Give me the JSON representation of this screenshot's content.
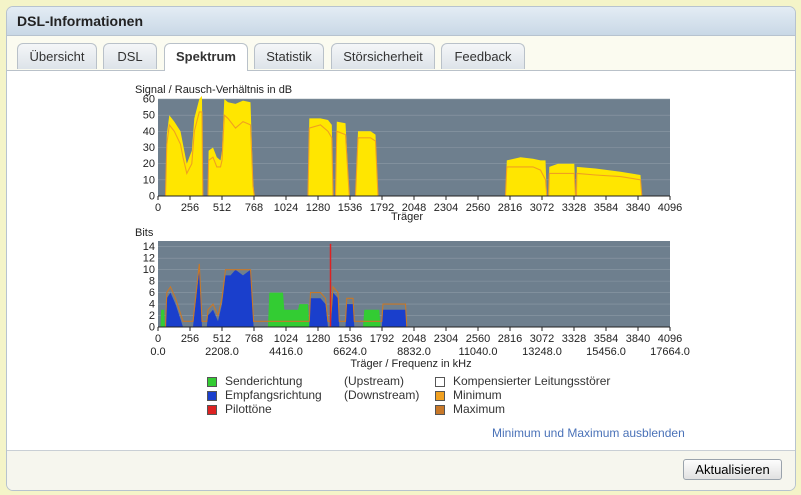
{
  "window": {
    "title": "DSL-Informationen"
  },
  "tabs": [
    {
      "label": "Übersicht",
      "active": false
    },
    {
      "label": "DSL",
      "active": false
    },
    {
      "label": "Spektrum",
      "active": true
    },
    {
      "label": "Statistik",
      "active": false
    },
    {
      "label": "Störsicherheit",
      "active": false
    },
    {
      "label": "Feedback",
      "active": false
    }
  ],
  "chart_data": [
    {
      "type": "area",
      "ylabel": "Signal / Rausch-Verhältnis in dB",
      "xlabel": "Träger",
      "xlim": [
        0,
        4096
      ],
      "ylim": [
        0,
        60
      ],
      "yticks": [
        "0",
        "10",
        "20",
        "30",
        "40",
        "50",
        "60"
      ],
      "xticks": [
        "0",
        "256",
        "512",
        "768",
        "1024",
        "1280",
        "1536",
        "1792",
        "2048",
        "2304",
        "2560",
        "2816",
        "3072",
        "3328",
        "3584",
        "3840",
        "4096"
      ],
      "grid": true,
      "series": [
        {
          "values": [
            [
              60,
              0
            ],
            [
              70,
              38
            ],
            [
              90,
              50
            ],
            [
              130,
              46
            ],
            [
              180,
              40
            ],
            [
              200,
              32
            ],
            [
              230,
              20
            ],
            [
              270,
              28
            ],
            [
              290,
              48
            ],
            [
              330,
              60
            ],
            [
              352,
              62
            ],
            [
              358,
              0
            ],
            [
              400,
              0
            ],
            [
              405,
              28
            ],
            [
              440,
              30
            ],
            [
              470,
              24
            ],
            [
              500,
              22
            ],
            [
              512,
              28
            ],
            [
              530,
              60
            ],
            [
              560,
              58
            ],
            [
              620,
              57
            ],
            [
              680,
              59
            ],
            [
              740,
              58
            ],
            [
              760,
              10
            ],
            [
              770,
              0
            ],
            [
              1200,
              0
            ],
            [
              1210,
              48
            ],
            [
              1300,
              48
            ],
            [
              1360,
              47
            ],
            [
              1390,
              44
            ],
            [
              1400,
              0
            ],
            [
              1420,
              0
            ],
            [
              1430,
              46
            ],
            [
              1500,
              45
            ],
            [
              1530,
              0
            ],
            [
              1580,
              0
            ],
            [
              1600,
              40
            ],
            [
              1700,
              40
            ],
            [
              1740,
              38
            ],
            [
              1760,
              0
            ],
            [
              1770,
              0
            ],
            [
              2780,
              0
            ],
            [
              2790,
              22
            ],
            [
              2900,
              24
            ],
            [
              3000,
              23
            ],
            [
              3060,
              22
            ],
            [
              3100,
              22
            ],
            [
              3110,
              0
            ],
            [
              3125,
              0
            ],
            [
              3130,
              18
            ],
            [
              3200,
              20
            ],
            [
              3330,
              20
            ],
            [
              3340,
              0
            ],
            [
              3348,
              0
            ],
            [
              3350,
              18
            ],
            [
              3500,
              17
            ],
            [
              3700,
              15
            ],
            [
              3860,
              13
            ],
            [
              3870,
              0
            ]
          ]
        },
        {
          "values": [
            [
              60,
              0
            ],
            [
              70,
              32
            ],
            [
              90,
              44
            ],
            [
              130,
              40
            ],
            [
              180,
              32
            ],
            [
              200,
              24
            ],
            [
              230,
              14
            ],
            [
              270,
              20
            ],
            [
              290,
              40
            ],
            [
              330,
              52
            ],
            [
              352,
              52
            ],
            [
              358,
              0
            ],
            [
              400,
              0
            ],
            [
              405,
              22
            ],
            [
              440,
              24
            ],
            [
              470,
              18
            ],
            [
              500,
              18
            ],
            [
              512,
              22
            ],
            [
              530,
              50
            ],
            [
              560,
              48
            ],
            [
              620,
              42
            ],
            [
              680,
              46
            ],
            [
              740,
              44
            ],
            [
              760,
              6
            ],
            [
              770,
              0
            ],
            [
              1200,
              0
            ],
            [
              1210,
              42
            ],
            [
              1300,
              44
            ],
            [
              1360,
              40
            ],
            [
              1390,
              36
            ],
            [
              1400,
              0
            ],
            [
              1420,
              0
            ],
            [
              1430,
              40
            ],
            [
              1500,
              38
            ],
            [
              1530,
              0
            ],
            [
              1580,
              0
            ],
            [
              1600,
              36
            ],
            [
              1700,
              36
            ],
            [
              1740,
              34
            ],
            [
              1760,
              0
            ],
            [
              1770,
              0
            ],
            [
              2780,
              0
            ],
            [
              2790,
              18
            ],
            [
              2900,
              18
            ],
            [
              3000,
              18
            ],
            [
              3060,
              16
            ],
            [
              3100,
              10
            ],
            [
              3110,
              0
            ],
            [
              3125,
              0
            ],
            [
              3130,
              14
            ],
            [
              3200,
              14
            ],
            [
              3330,
              14
            ],
            [
              3340,
              0
            ],
            [
              3348,
              0
            ],
            [
              3350,
              14
            ],
            [
              3500,
              13
            ],
            [
              3700,
              12
            ],
            [
              3860,
              10
            ],
            [
              3870,
              0
            ]
          ]
        }
      ]
    },
    {
      "type": "area",
      "ylabel": "Bits",
      "xlabel": "Träger / Frequenz in kHz",
      "xlim": [
        0,
        4096
      ],
      "ylim": [
        0,
        15
      ],
      "yticks": [
        "0",
        "2",
        "4",
        "6",
        "8",
        "10",
        "12",
        "14"
      ],
      "xticks": [
        "0",
        "256",
        "512",
        "768",
        "1024",
        "1280",
        "1536",
        "1792",
        "2048",
        "2304",
        "2560",
        "2816",
        "3072",
        "3328",
        "3584",
        "3840",
        "4096"
      ],
      "xticks_freq": [
        "0.0",
        "2208.0",
        "4416.0",
        "6624.0",
        "8832.0",
        "11040.0",
        "13248.0",
        "15456.0",
        "17664.0"
      ],
      "grid": true,
      "series": [
        {
          "name": "Senderichtung",
          "values": [
            [
              20,
              0
            ],
            [
              25,
              3
            ],
            [
              50,
              3
            ],
            [
              55,
              0
            ],
            [
              880,
              0
            ],
            [
              890,
              6
            ],
            [
              1000,
              6
            ],
            [
              1010,
              3
            ],
            [
              1120,
              3
            ],
            [
              1130,
              4
            ],
            [
              1200,
              4
            ],
            [
              1210,
              0
            ],
            [
              1640,
              0
            ],
            [
              1650,
              3
            ],
            [
              1770,
              3
            ],
            [
              1780,
              0
            ]
          ]
        },
        {
          "name": "Empfangsrichtung",
          "values": [
            [
              60,
              0
            ],
            [
              70,
              5
            ],
            [
              100,
              6
            ],
            [
              140,
              4
            ],
            [
              170,
              2
            ],
            [
              200,
              0
            ],
            [
              280,
              0
            ],
            [
              330,
              10
            ],
            [
              352,
              0
            ],
            [
              390,
              0
            ],
            [
              400,
              2
            ],
            [
              440,
              3
            ],
            [
              480,
              1
            ],
            [
              512,
              4
            ],
            [
              540,
              9
            ],
            [
              580,
              9
            ],
            [
              620,
              10
            ],
            [
              680,
              9
            ],
            [
              740,
              10
            ],
            [
              765,
              0
            ],
            [
              1210,
              0
            ],
            [
              1220,
              5
            ],
            [
              1300,
              5
            ],
            [
              1340,
              4
            ],
            [
              1360,
              0
            ],
            [
              1380,
              0
            ],
            [
              1400,
              6
            ],
            [
              1440,
              5
            ],
            [
              1450,
              0
            ],
            [
              1500,
              0
            ],
            [
              1510,
              4
            ],
            [
              1560,
              4
            ],
            [
              1570,
              0
            ],
            [
              1790,
              0
            ],
            [
              1800,
              3
            ],
            [
              1980,
              3
            ],
            [
              1990,
              0
            ]
          ]
        },
        {
          "name": "Maximum",
          "values": [
            [
              60,
              0
            ],
            [
              70,
              6
            ],
            [
              100,
              7
            ],
            [
              140,
              5
            ],
            [
              170,
              3
            ],
            [
              200,
              1
            ],
            [
              280,
              1
            ],
            [
              330,
              11
            ],
            [
              352,
              1
            ],
            [
              390,
              1
            ],
            [
              400,
              3
            ],
            [
              440,
              4
            ],
            [
              480,
              2
            ],
            [
              512,
              5
            ],
            [
              540,
              10
            ],
            [
              580,
              10
            ],
            [
              620,
              10
            ],
            [
              680,
              10
            ],
            [
              740,
              10
            ],
            [
              765,
              1
            ],
            [
              1210,
              1
            ],
            [
              1220,
              6
            ],
            [
              1300,
              6
            ],
            [
              1340,
              5
            ],
            [
              1360,
              1
            ],
            [
              1380,
              1
            ],
            [
              1400,
              7
            ],
            [
              1440,
              6
            ],
            [
              1450,
              1
            ],
            [
              1500,
              1
            ],
            [
              1510,
              5
            ],
            [
              1560,
              5
            ],
            [
              1570,
              1
            ],
            [
              1790,
              1
            ],
            [
              1800,
              4
            ],
            [
              1980,
              4
            ],
            [
              1990,
              0
            ]
          ]
        },
        {
          "name": "Pilottöne",
          "values": [
            [
              1380,
              14.5
            ]
          ]
        }
      ]
    }
  ],
  "legend": {
    "items": [
      {
        "label": "Senderichtung",
        "note": "(Upstream)",
        "color": "#33cc33"
      },
      {
        "label": "Empfangsrichtung",
        "note": "(Downstream)",
        "color": "#1a3fcc"
      },
      {
        "label": "Pilottöne",
        "color": "#dd2222"
      },
      {
        "label": "Kompensierter Leitungsstörer",
        "color": "#ffffff"
      },
      {
        "label": "Minimum",
        "color": "#f0a020"
      },
      {
        "label": "Maximum",
        "color": "#c87828"
      }
    ]
  },
  "toggle_link": "Minimum und Maximum ausblenden",
  "footer": {
    "refresh_label": "Aktualisieren"
  }
}
